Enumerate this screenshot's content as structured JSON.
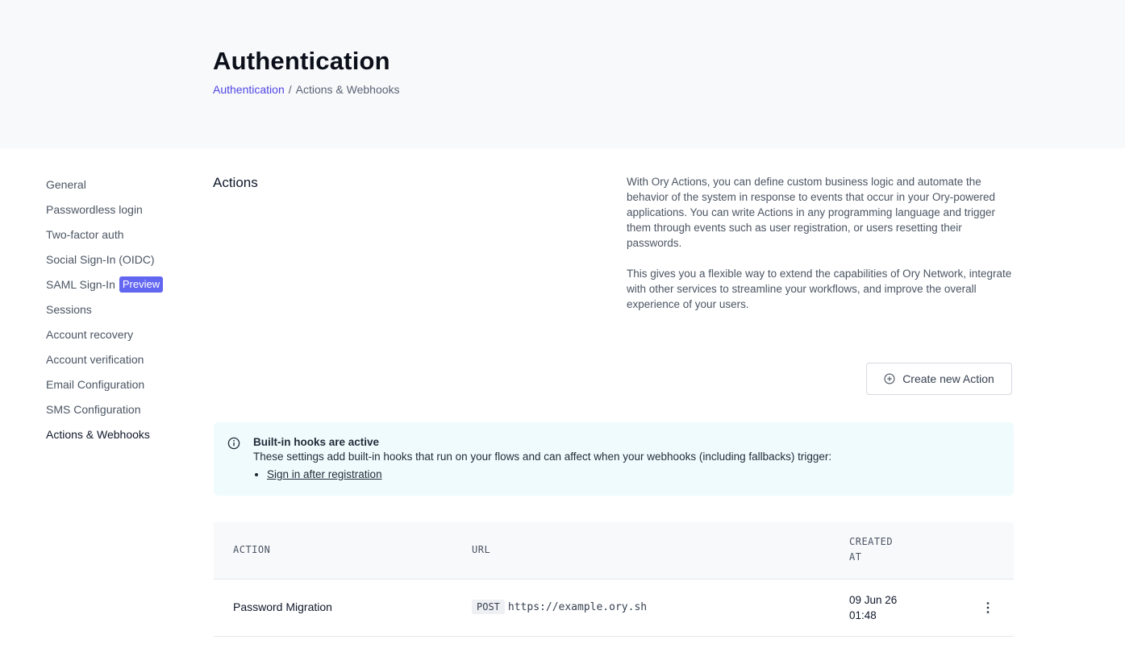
{
  "header": {
    "title": "Authentication",
    "breadcrumb": {
      "link": "Authentication",
      "separator": "/",
      "current": "Actions & Webhooks"
    }
  },
  "sidebar": {
    "items": [
      {
        "label": "General"
      },
      {
        "label": "Passwordless login"
      },
      {
        "label": "Two-factor auth"
      },
      {
        "label": "Social Sign-In (OIDC)"
      },
      {
        "label": "SAML Sign-In",
        "badge": "Preview"
      },
      {
        "label": "Sessions"
      },
      {
        "label": "Account recovery"
      },
      {
        "label": "Account verification"
      },
      {
        "label": "Email Configuration"
      },
      {
        "label": "SMS Configuration"
      },
      {
        "label": "Actions & Webhooks",
        "active": true
      }
    ]
  },
  "main": {
    "section_title": "Actions",
    "description": [
      "With Ory Actions, you can define custom business logic and automate the behavior of the system in response to events that occur in your Ory-powered applications. You can write Actions in any programming language and trigger them through events such as user registration, or users resetting their passwords.",
      "This gives you a flexible way to extend the capabilities of Ory Network, integrate with other services to streamline your workflows, and improve the overall experience of your users."
    ],
    "create_button": {
      "label": "Create new Action",
      "icon": "plus-circle-icon"
    },
    "info": {
      "icon": "info-circle-icon",
      "title": "Built-in hooks are active",
      "text": "These settings add built-in hooks that run on your flows and can affect when your webhooks (including fallbacks) trigger:",
      "items": [
        "Sign in after registration"
      ]
    },
    "table": {
      "columns": [
        "ACTION",
        "URL",
        "CREATED AT"
      ],
      "rows": [
        {
          "action": "Password Migration",
          "method": "POST",
          "url": "https://example.ory.sh",
          "created_date": "09 Jun 26",
          "created_time": "01:48",
          "menu_icon": "more-vertical-icon"
        }
      ]
    }
  },
  "colors": {
    "accent": "#4f46e5",
    "badge": "#6366f1",
    "info_bg": "#f0fbfd",
    "header_bg": "#f8f9fb"
  }
}
